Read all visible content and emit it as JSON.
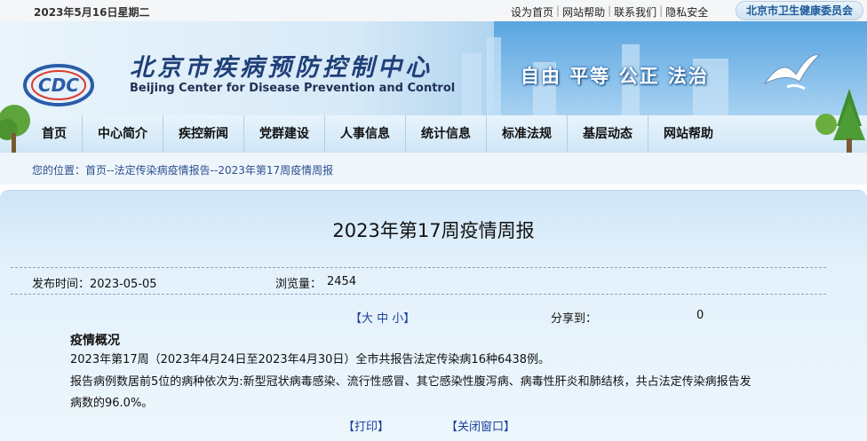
{
  "topbar": {
    "date": "2023年5月16日星期二",
    "links": [
      "设为首页",
      "网站帮助",
      "联系我们",
      "隐私安全"
    ],
    "commission": "北京市卫生健康委员会"
  },
  "banner": {
    "title_cn": "北京市疾病预防控制中心",
    "title_en": "Beijing Center for Disease  Prevention and Control",
    "slogan": "自由 平等 公正 法治",
    "logo_text": "CDC"
  },
  "nav": {
    "items": [
      "首页",
      "中心简介",
      "疾控新闻",
      "党群建设",
      "人事信息",
      "统计信息",
      "标准法规",
      "基层动态",
      "网站帮助"
    ]
  },
  "breadcrumb": {
    "text": "您的位置：首页--法定传染病疫情报告--2023年第17周疫情周报"
  },
  "article": {
    "title": "2023年第17周疫情周报",
    "pub_label": "发布时间：2023-05-05",
    "views_label": "浏览量：",
    "views_value": "2454",
    "font_size_label": "【大 中 小】",
    "share_label": "分享到：",
    "share_count": "0",
    "section_heading": "疫情概况",
    "para1": "2023年第17周（2023年4月24日至2023年4月30日）全市共报告法定传染病16种6438例。",
    "para2_line1": "报告病例数居前5位的病种依次为:新型冠状病毒感染、流行性感冒、其它感染性腹泻病、病毒性肝炎和肺结核，共占法定传染病报告发",
    "para2_line2": "病数的96.0%。",
    "print_label": "【打印】",
    "close_label": "【关闭窗口】"
  },
  "colors": {
    "accent_blue": "#1f3f78",
    "link_blue": "#1a3f9a",
    "nav_bg": "#dcecf8"
  }
}
